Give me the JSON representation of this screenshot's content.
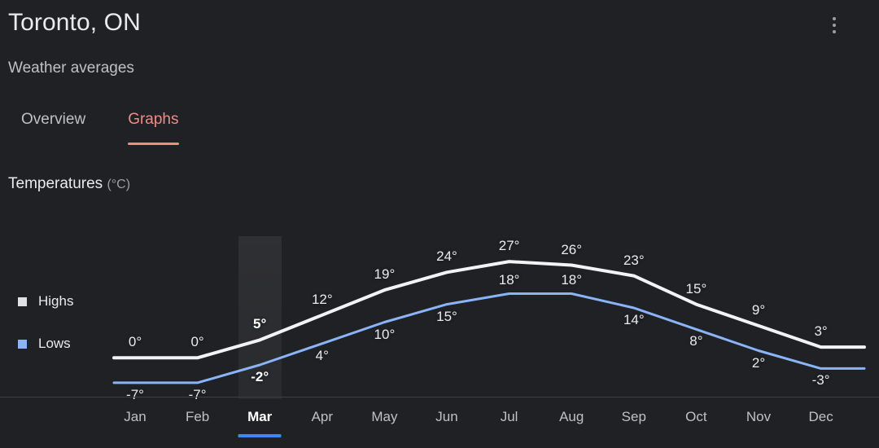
{
  "header": {
    "title": "Toronto, ON",
    "subtitle": "Weather averages",
    "menu_icon": "more-vertical-icon"
  },
  "tabs": [
    {
      "label": "Overview",
      "active": false
    },
    {
      "label": "Graphs",
      "active": true
    }
  ],
  "section": {
    "label": "Temperatures",
    "unit": "(°C)"
  },
  "legend": [
    {
      "label": "Highs",
      "color": "#dfe1e5"
    },
    {
      "label": "Lows",
      "color": "#8ab4f8"
    }
  ],
  "selected_month": "Mar",
  "colors": {
    "background": "#202124",
    "accent": "#f28b82",
    "highs_line": "#f1f3f4",
    "lows_line": "#8ab4f8",
    "month_marker": "#4285f4",
    "axis": "#3c4043"
  },
  "chart_data": {
    "type": "line",
    "title": "Temperatures (°C)",
    "xlabel": "",
    "ylabel": "",
    "categories": [
      "Jan",
      "Feb",
      "Mar",
      "Apr",
      "May",
      "Jun",
      "Jul",
      "Aug",
      "Sep",
      "Oct",
      "Nov",
      "Dec"
    ],
    "series": [
      {
        "name": "Highs",
        "color": "#f1f3f4",
        "values": [
          0,
          0,
          5,
          12,
          19,
          24,
          27,
          26,
          23,
          15,
          9,
          3
        ],
        "labels": [
          "0°",
          "0°",
          "5°",
          "12°",
          "19°",
          "24°",
          "27°",
          "26°",
          "23°",
          "15°",
          "9°",
          "3°"
        ]
      },
      {
        "name": "Lows",
        "color": "#8ab4f8",
        "values": [
          -7,
          -7,
          -2,
          4,
          10,
          15,
          18,
          18,
          14,
          8,
          2,
          -3
        ],
        "labels": [
          "-7°",
          "-7°",
          "-2°",
          "4°",
          "10°",
          "15°",
          "18°",
          "18°",
          "14°",
          "8°",
          "2°",
          "-3°"
        ]
      }
    ],
    "ylim": [
      -10,
      30
    ],
    "grid": false,
    "legend_position": "left"
  }
}
